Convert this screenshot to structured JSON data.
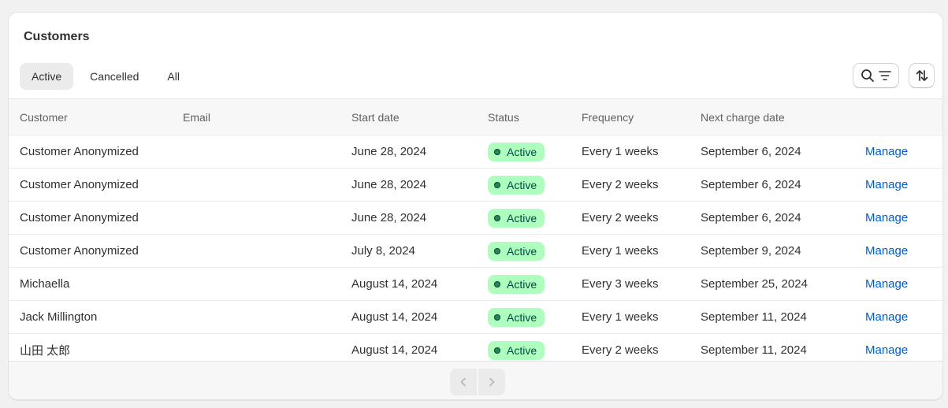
{
  "card": {
    "title": "Customers"
  },
  "tabs": [
    {
      "label": "Active",
      "selected": true
    },
    {
      "label": "Cancelled",
      "selected": false
    },
    {
      "label": "All",
      "selected": false
    }
  ],
  "toolbar": {
    "search_filter_icons": [
      "search-icon",
      "filter-icon"
    ],
    "sort_icon": "sort-icon"
  },
  "table": {
    "columns": [
      "Customer",
      "Email",
      "Start date",
      "Status",
      "Frequency",
      "Next charge date"
    ],
    "rows": [
      {
        "customer": "Customer Anonymized",
        "email": "",
        "start_date": "June 28, 2024",
        "status": "Active",
        "frequency": "Every 1 weeks",
        "next_charge": "September 6, 2024",
        "action": "Manage"
      },
      {
        "customer": "Customer Anonymized",
        "email": "",
        "start_date": "June 28, 2024",
        "status": "Active",
        "frequency": "Every 2 weeks",
        "next_charge": "September 6, 2024",
        "action": "Manage"
      },
      {
        "customer": "Customer Anonymized",
        "email": "",
        "start_date": "June 28, 2024",
        "status": "Active",
        "frequency": "Every 2 weeks",
        "next_charge": "September 6, 2024",
        "action": "Manage"
      },
      {
        "customer": "Customer Anonymized",
        "email": "",
        "start_date": "July 8, 2024",
        "status": "Active",
        "frequency": "Every 1 weeks",
        "next_charge": "September 9, 2024",
        "action": "Manage"
      },
      {
        "customer": "Michaella",
        "email": "",
        "start_date": "August 14, 2024",
        "status": "Active",
        "frequency": "Every 3 weeks",
        "next_charge": "September 25, 2024",
        "action": "Manage"
      },
      {
        "customer": "Jack Millington",
        "email": "",
        "start_date": "August 14, 2024",
        "status": "Active",
        "frequency": "Every 1 weeks",
        "next_charge": "September 11, 2024",
        "action": "Manage"
      },
      {
        "customer": "山田 太郎",
        "email": "",
        "start_date": "August 14, 2024",
        "status": "Active",
        "frequency": "Every 2 weeks",
        "next_charge": "September 11, 2024",
        "action": "Manage"
      }
    ]
  },
  "pagination": {
    "prev_icon": "chevron-left-icon",
    "next_icon": "chevron-right-icon"
  },
  "colors": {
    "badge_bg": "#affebf",
    "badge_text": "#014b40",
    "badge_dot": "#29845a",
    "link": "#005bd3"
  }
}
